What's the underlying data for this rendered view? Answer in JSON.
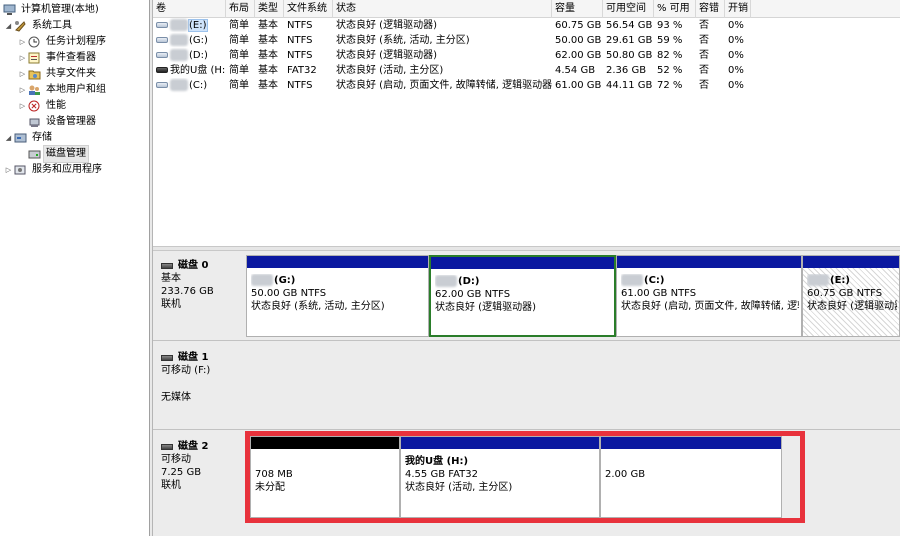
{
  "tree": {
    "items": [
      {
        "label": "计算机管理(本地)",
        "icon": "computer-management-icon",
        "twisty": ""
      },
      {
        "label": "系统工具",
        "icon": "system-tools-icon",
        "twisty": "◢"
      },
      {
        "label": "任务计划程序",
        "icon": "task-scheduler-icon",
        "twisty": "▷"
      },
      {
        "label": "事件查看器",
        "icon": "event-viewer-icon",
        "twisty": "▷"
      },
      {
        "label": "共享文件夹",
        "icon": "shared-folders-icon",
        "twisty": "▷"
      },
      {
        "label": "本地用户和组",
        "icon": "local-users-icon",
        "twisty": "▷"
      },
      {
        "label": "性能",
        "icon": "performance-icon",
        "twisty": "▷"
      },
      {
        "label": "设备管理器",
        "icon": "device-manager-icon",
        "twisty": ""
      },
      {
        "label": "存储",
        "icon": "storage-icon",
        "twisty": "◢"
      },
      {
        "label": "磁盘管理",
        "icon": "disk-management-icon",
        "twisty": ""
      },
      {
        "label": "服务和应用程序",
        "icon": "services-apps-icon",
        "twisty": "▷"
      }
    ]
  },
  "volumes": {
    "headers": [
      "卷",
      "布局",
      "类型",
      "文件系统",
      "状态",
      "容量",
      "可用空间",
      "% 可用",
      "容错",
      "开销"
    ],
    "rows": [
      {
        "name": "(E:)",
        "layout": "简单",
        "type": "基本",
        "fs": "NTFS",
        "status": "状态良好 (逻辑驱动器)",
        "capacity": "60.75 GB",
        "free": "56.54 GB",
        "pct": "93 %",
        "fault": "否",
        "overhead": "0%"
      },
      {
        "name": "(G:)",
        "layout": "简单",
        "type": "基本",
        "fs": "NTFS",
        "status": "状态良好 (系统, 活动, 主分区)",
        "capacity": "50.00 GB",
        "free": "29.61 GB",
        "pct": "59 %",
        "fault": "否",
        "overhead": "0%"
      },
      {
        "name": "(D:)",
        "layout": "简单",
        "type": "基本",
        "fs": "NTFS",
        "status": "状态良好 (逻辑驱动器)",
        "capacity": "62.00 GB",
        "free": "50.80 GB",
        "pct": "82 %",
        "fault": "否",
        "overhead": "0%"
      },
      {
        "name": "我的U盘 (H:)",
        "layout": "简单",
        "type": "基本",
        "fs": "FAT32",
        "status": "状态良好 (活动, 主分区)",
        "capacity": "4.54 GB",
        "free": "2.36 GB",
        "pct": "52 %",
        "fault": "否",
        "overhead": "0%"
      },
      {
        "name": "(C:)",
        "layout": "简单",
        "type": "基本",
        "fs": "NTFS",
        "status": "状态良好 (启动, 页面文件, 故障转储, 逻辑驱动器)",
        "capacity": "61.00 GB",
        "free": "44.11 GB",
        "pct": "72 %",
        "fault": "否",
        "overhead": "0%"
      }
    ]
  },
  "disks": [
    {
      "name": "磁盘 0",
      "type": "基本",
      "size": "233.76 GB",
      "state": "联机",
      "partitions": [
        {
          "title": "(G:)",
          "size": "50.00 GB NTFS",
          "status": "状态良好 (系统, 活动, 主分区)"
        },
        {
          "title": "(D:)",
          "size": "62.00 GB NTFS",
          "status": "状态良好 (逻辑驱动器)"
        },
        {
          "title": "(C:)",
          "size": "61.00 GB NTFS",
          "status": "状态良好 (启动, 页面文件, 故障转储, 逻辑驱"
        },
        {
          "title": "(E:)",
          "size": "60.75 GB NTFS",
          "status": "状态良好 (逻辑驱动器"
        }
      ]
    },
    {
      "name": "磁盘 1",
      "type": "可移动 (F:)",
      "media": "无媒体"
    },
    {
      "name": "磁盘 2",
      "type": "可移动",
      "size": "7.25 GB",
      "state": "联机",
      "partitions": [
        {
          "title": "",
          "size": "708 MB",
          "status": "未分配"
        },
        {
          "title": "我的U盘  (H:)",
          "size": "4.55 GB FAT32",
          "status": "状态良好 (活动, 主分区)"
        },
        {
          "title": "",
          "size": "2.00 GB",
          "status": ""
        }
      ]
    }
  ],
  "colors": {
    "primary_partition": "#0a18a0",
    "unallocated": "#000000",
    "highlight_box": "#e8323c",
    "active_border": "#2a7d2a"
  }
}
